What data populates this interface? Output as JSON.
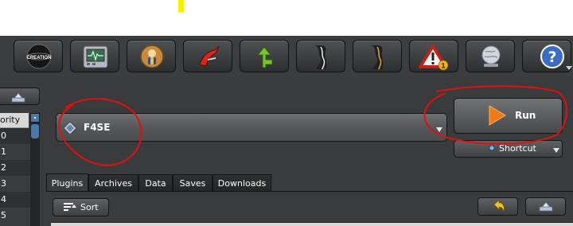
{
  "toolbar": {
    "buttons": [
      {
        "name": "creation-kit-icon",
        "text": "CREATION"
      },
      {
        "name": "executable-icon"
      },
      {
        "name": "vault-boy-icon"
      },
      {
        "name": "tools-icon"
      },
      {
        "name": "path-icon"
      },
      {
        "name": "profile-left-icon"
      },
      {
        "name": "profile-right-icon"
      },
      {
        "name": "warning-icon",
        "badge": "1"
      },
      {
        "name": "globe-icon"
      },
      {
        "name": "help-icon",
        "text": "?"
      }
    ]
  },
  "left_pane": {
    "column_header": "ority",
    "priorities": [
      "0",
      "1",
      "2",
      "3",
      "4",
      "5"
    ]
  },
  "executable": {
    "selected": "F4SE"
  },
  "run": {
    "label": "Run"
  },
  "shortcut": {
    "label": "Shortcut"
  },
  "tabs": [
    {
      "label": "Plugins",
      "active": true
    },
    {
      "label": "Archives",
      "active": false
    },
    {
      "label": "Data",
      "active": false
    },
    {
      "label": "Saves",
      "active": false
    },
    {
      "label": "Downloads",
      "active": false
    }
  ],
  "plugins_panel": {
    "sort_label": "Sort"
  },
  "colors": {
    "background": "#3a3b3c",
    "run_triangle": "#f07a1a",
    "annotation": "#e01010",
    "highlight": "#f5f000"
  }
}
